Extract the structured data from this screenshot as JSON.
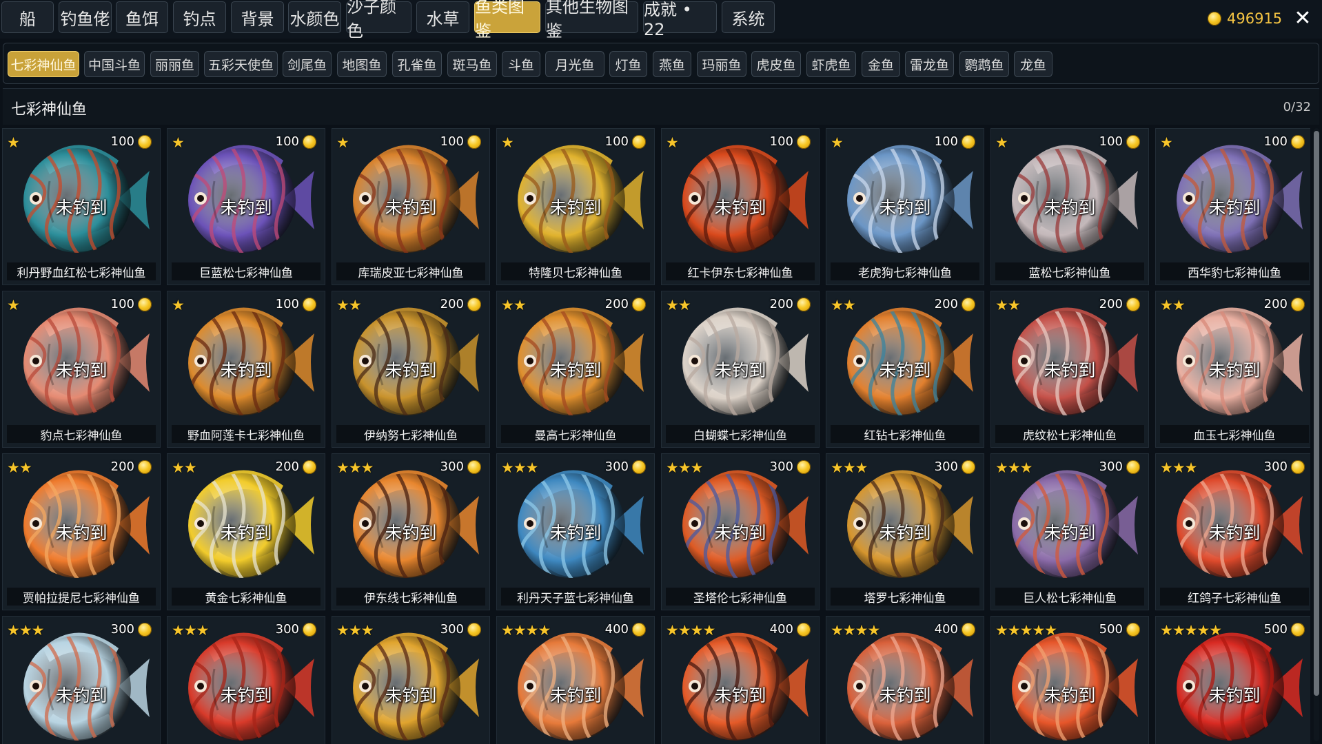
{
  "top_menu": {
    "tabs": [
      {
        "label": "船"
      },
      {
        "label": "钓鱼佬"
      },
      {
        "label": "鱼饵"
      },
      {
        "label": "钓点"
      },
      {
        "label": "背景"
      },
      {
        "label": "水颜色"
      },
      {
        "label": "沙子颜色"
      },
      {
        "label": "水草"
      },
      {
        "label": "鱼类图鉴",
        "active": true
      },
      {
        "label": "其他生物图鉴"
      },
      {
        "label": "成就 • 22"
      },
      {
        "label": "系统"
      }
    ],
    "coins": "496915",
    "coin_icon": "coin-icon",
    "close_icon": "close-icon",
    "close_glyph": "✕"
  },
  "categories": {
    "items": [
      {
        "label": "七彩神仙鱼",
        "active": true
      },
      {
        "label": "中国斗鱼"
      },
      {
        "label": "丽丽鱼"
      },
      {
        "label": "五彩天使鱼"
      },
      {
        "label": "剑尾鱼"
      },
      {
        "label": "地图鱼"
      },
      {
        "label": "孔雀鱼"
      },
      {
        "label": "斑马鱼"
      },
      {
        "label": "斗鱼"
      },
      {
        "label": "月光鱼"
      },
      {
        "label": "灯鱼"
      },
      {
        "label": "燕鱼"
      },
      {
        "label": "玛丽鱼"
      },
      {
        "label": "虎皮鱼"
      },
      {
        "label": "虾虎鱼"
      },
      {
        "label": "金鱼"
      },
      {
        "label": "雷龙鱼"
      },
      {
        "label": "鹦鹉鱼"
      },
      {
        "label": "龙鱼"
      }
    ]
  },
  "section": {
    "title": "七彩神仙鱼",
    "count": "0/32"
  },
  "status_label": "未钓到",
  "colors": {
    "accent_gold": "#c9a239",
    "coin": "#f5c443",
    "star": "#f7c52a",
    "panel_bg": "#151e26"
  },
  "fish": [
    {
      "name": "利丹野血红松七彩神仙鱼",
      "stars": "★",
      "price": "100",
      "color": "#2c8e9a",
      "stripe": "#c94a2a"
    },
    {
      "name": "巨蓝松七彩神仙鱼",
      "stars": "★",
      "price": "100",
      "color": "#6b52b8",
      "stripe": "#c24a78"
    },
    {
      "name": "库瑞皮亚七彩神仙鱼",
      "stars": "★",
      "price": "100",
      "color": "#d8822c",
      "stripe": "#8a3418"
    },
    {
      "name": "特隆贝七彩神仙鱼",
      "stars": "★",
      "price": "100",
      "color": "#e0b22e",
      "stripe": "#9a5a1a"
    },
    {
      "name": "红卡伊东七彩神仙鱼",
      "stars": "★",
      "price": "100",
      "color": "#d8491c",
      "stripe": "#5a1a0c"
    },
    {
      "name": "老虎狗七彩神仙鱼",
      "stars": "★",
      "price": "100",
      "color": "#6b96c6",
      "stripe": "#c8d8ee"
    },
    {
      "name": "蓝松七彩神仙鱼",
      "stars": "★",
      "price": "100",
      "color": "#c4b8ba",
      "stripe": "#9a3a3a"
    },
    {
      "name": "西华豹七彩神仙鱼",
      "stars": "★",
      "price": "100",
      "color": "#7d6fb4",
      "stripe": "#c45a3a"
    },
    {
      "name": "豹点七彩神仙鱼",
      "stars": "★",
      "price": "100",
      "color": "#e58a72",
      "stripe": "#b84a3a"
    },
    {
      "name": "野血阿莲卡七彩神仙鱼",
      "stars": "★",
      "price": "100",
      "color": "#dc8a2c",
      "stripe": "#6a2a10"
    },
    {
      "name": "伊纳努七彩神仙鱼",
      "stars": "★★",
      "price": "200",
      "color": "#c8922c",
      "stripe": "#4a2a16"
    },
    {
      "name": "曼高七彩神仙鱼",
      "stars": "★★",
      "price": "200",
      "color": "#e0902e",
      "stripe": "#a44a20"
    },
    {
      "name": "白蝴蝶七彩神仙鱼",
      "stars": "★★",
      "price": "200",
      "color": "#dcd2c8",
      "stripe": "#b8aaa0"
    },
    {
      "name": "红钻七彩神仙鱼",
      "stars": "★★",
      "price": "200",
      "color": "#e2802e",
      "stripe": "#3a84a0"
    },
    {
      "name": "虎纹松七彩神仙鱼",
      "stars": "★★",
      "price": "200",
      "color": "#c45048",
      "stripe": "#e8c8c0"
    },
    {
      "name": "血玉七彩神仙鱼",
      "stars": "★★",
      "price": "200",
      "color": "#eab0a2",
      "stripe": "#d88a7a"
    },
    {
      "name": "贾帕拉提尼七彩神仙鱼",
      "stars": "★★",
      "price": "200",
      "color": "#ee7a2c",
      "stripe": "#f4a860"
    },
    {
      "name": "黄金七彩神仙鱼",
      "stars": "★★",
      "price": "200",
      "color": "#f2cc2c",
      "stripe": "#e8e4d0"
    },
    {
      "name": "伊东线七彩神仙鱼",
      "stars": "★★★",
      "price": "300",
      "color": "#e8862e",
      "stripe": "#4a2010"
    },
    {
      "name": "利丹天子蓝七彩神仙鱼",
      "stars": "★★★",
      "price": "300",
      "color": "#3e88c0",
      "stripe": "#8ec8e8"
    },
    {
      "name": "圣塔伦七彩神仙鱼",
      "stars": "★★★",
      "price": "300",
      "color": "#de5a24",
      "stripe": "#4a5aa0"
    },
    {
      "name": "塔罗七彩神仙鱼",
      "stars": "★★★",
      "price": "300",
      "color": "#d6962e",
      "stripe": "#4a2a18"
    },
    {
      "name": "巨人松七彩神仙鱼",
      "stars": "★★★",
      "price": "300",
      "color": "#8a6aa8",
      "stripe": "#d45a3a"
    },
    {
      "name": "红鸽子七彩神仙鱼",
      "stars": "★★★",
      "price": "300",
      "color": "#de4a2c",
      "stripe": "#f0a890"
    },
    {
      "name": "",
      "stars": "★★★",
      "price": "300",
      "color": "#b8d4e2",
      "stripe": "#d06a4a"
    },
    {
      "name": "",
      "stars": "★★★",
      "price": "300",
      "color": "#d83a2a",
      "stripe": "#a82418"
    },
    {
      "name": "",
      "stars": "★★★",
      "price": "300",
      "color": "#e0a42e",
      "stripe": "#5a2a14"
    },
    {
      "name": "",
      "stars": "★★★★",
      "price": "400",
      "color": "#e67a3a",
      "stripe": "#f0b080"
    },
    {
      "name": "",
      "stars": "★★★★",
      "price": "400",
      "color": "#e45a28",
      "stripe": "#4a1a10"
    },
    {
      "name": "",
      "stars": "★★★★",
      "price": "400",
      "color": "#d8603a",
      "stripe": "#f0a890"
    },
    {
      "name": "",
      "stars": "★★★★★",
      "price": "500",
      "color": "#e6562a",
      "stripe": "#f2a070"
    },
    {
      "name": "",
      "stars": "★★★★★",
      "price": "500",
      "color": "#d82a22",
      "stripe": "#b01810"
    }
  ]
}
